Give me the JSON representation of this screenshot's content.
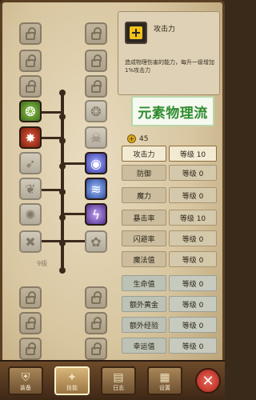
{
  "skill": {
    "title": "攻击力",
    "description": "造成物理伤害的能力，每升一级增加1%攻击力"
  },
  "banner_text": "元素物理流",
  "points": {
    "value": "45",
    "coin_icon": "plus-coin-icon"
  },
  "divider_label": "9级",
  "stats": [
    {
      "name": "攻击力",
      "level": "等级 10"
    },
    {
      "name": "防御",
      "level": "等级 0"
    },
    {
      "name": "魔力",
      "level": "等级 0"
    },
    {
      "name": "暴击率",
      "level": "等级 10"
    },
    {
      "name": "闪避率",
      "level": "等级 0"
    },
    {
      "name": "魔法值",
      "level": "等级 0"
    },
    {
      "name": "生命值",
      "level": "等级 0"
    },
    {
      "name": "额外黄金",
      "level": "等级 0"
    },
    {
      "name": "额外经验",
      "level": "等级 0"
    },
    {
      "name": "幸运值",
      "level": "等级 0"
    }
  ],
  "nav": [
    {
      "label": "装备",
      "icon": "shield-icon"
    },
    {
      "label": "技能",
      "icon": "skill-icon"
    },
    {
      "label": "日志",
      "icon": "book-icon"
    },
    {
      "label": "设置",
      "icon": "map-icon"
    }
  ],
  "close_icon": "close-icon",
  "colors": {
    "banner_text": "#2f8c2f",
    "accent": "#f2c21a",
    "close": "#c8342a"
  }
}
